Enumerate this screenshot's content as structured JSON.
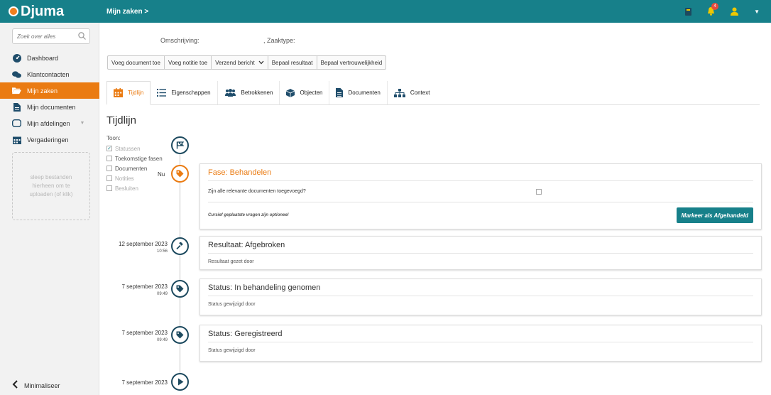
{
  "app": {
    "logo_text": "Djuma",
    "breadcrumb": "Mijn zaken >",
    "notifications_count": "4"
  },
  "sidebar": {
    "search_placeholder": "Zoek over alles",
    "items": [
      {
        "label": "Dashboard",
        "icon": "dashboard-icon",
        "active": false
      },
      {
        "label": "Klantcontacten",
        "icon": "contacts-icon",
        "active": false
      },
      {
        "label": "Mijn zaken",
        "icon": "folder-icon",
        "active": true
      },
      {
        "label": "Mijn documenten",
        "icon": "document-icon",
        "active": false
      },
      {
        "label": "Mijn afdelingen",
        "icon": "department-icon",
        "active": false
      },
      {
        "label": "Vergaderingen",
        "icon": "calendar-icon",
        "active": false
      }
    ],
    "dropzone_text": "sleep bestanden hierheen om te uploaden (of klik)",
    "minimize_label": "Minimaliseer"
  },
  "meta": {
    "description_label": "Omschrijving:",
    "zaaktype_label": ", Zaaktype:"
  },
  "toolbar": {
    "add_document": "Voeg document toe",
    "add_note": "Voeg notitie toe",
    "send_message": "Verzend bericht",
    "determine_result": "Bepaal resultaat",
    "determine_confidentiality": "Bepaal vertrouwelijkheid"
  },
  "tabs": [
    {
      "label": "Tijdlijn",
      "icon": "calendar-icon",
      "active": true
    },
    {
      "label": "Eigenschappen",
      "icon": "list-icon",
      "active": false
    },
    {
      "label": "Betrokkenen",
      "icon": "users-icon",
      "active": false
    },
    {
      "label": "Objecten",
      "icon": "cube-icon",
      "active": false
    },
    {
      "label": "Documenten",
      "icon": "file-icon",
      "active": false
    },
    {
      "label": "Context",
      "icon": "sitemap-icon",
      "active": false
    }
  ],
  "page_title": "Tijdlijn",
  "filters": {
    "label": "Toon:",
    "options": [
      {
        "label": "Statussen",
        "checked": true,
        "disabled": false
      },
      {
        "label": "Toekomstige fasen",
        "checked": false,
        "disabled": false
      },
      {
        "label": "Documenten",
        "checked": false,
        "disabled": false
      },
      {
        "label": "Notities",
        "checked": false,
        "disabled": true
      },
      {
        "label": "Besluiten",
        "checked": false,
        "disabled": true
      }
    ]
  },
  "timeline": {
    "now_label": "Nu",
    "phase_card": {
      "title": "Fase: Behandelen",
      "question": "Zijn alle relevante documenten toegevoegd?",
      "note": "Cursief geplaatste vragen zijn optioneel",
      "button": "Markeer als Afgehandeld"
    },
    "events": [
      {
        "date": "12 september 2023",
        "time": "10:56",
        "title": "Resultaat: Afgebroken",
        "sub": "Resultaat gezet door",
        "icon": "gavel-icon"
      },
      {
        "date": "7 september 2023",
        "time": "09:49",
        "title": "Status: In behandeling genomen",
        "sub": "Status gewijzigd door",
        "icon": "tag-icon"
      },
      {
        "date": "7 september 2023",
        "time": "09:49",
        "title": "Status: Geregistreerd",
        "sub": "Status gewijzigd door",
        "icon": "tag-icon"
      }
    ],
    "start_date": "7 september 2023"
  },
  "colors": {
    "teal": "#17808a",
    "orange": "#ea7b12",
    "navy": "#1d4a5f"
  }
}
